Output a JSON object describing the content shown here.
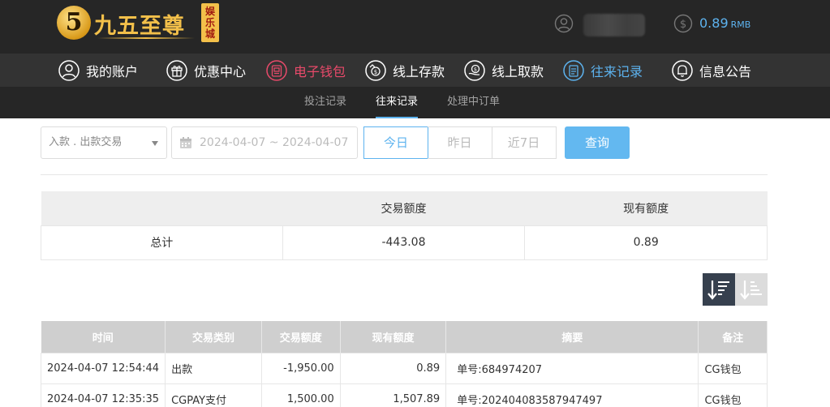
{
  "brand": {
    "logo_mark": "5",
    "name": "九五至尊",
    "badge": "娱乐城"
  },
  "account": {
    "balance": "0.89",
    "currency": "RMB",
    "user_icon": "user-avatar-icon",
    "balance_icon": "dollar-coin-icon"
  },
  "main_nav": [
    {
      "label": "我的账户",
      "icon": "user-icon"
    },
    {
      "label": "优惠中心",
      "icon": "gift-icon"
    },
    {
      "label": "电子钱包",
      "icon": "wallet-icon"
    },
    {
      "label": "线上存款",
      "icon": "deposit-icon"
    },
    {
      "label": "线上取款",
      "icon": "withdraw-icon"
    },
    {
      "label": "往来记录",
      "icon": "records-icon"
    },
    {
      "label": "信息公告",
      "icon": "bell-icon"
    }
  ],
  "sub_nav": [
    {
      "label": "投注记录"
    },
    {
      "label": "往来记录"
    },
    {
      "label": "处理中订单"
    }
  ],
  "filters": {
    "type_select": "入款 . 出款交易",
    "date_range": "2024-04-07 ~ 2024-04-07",
    "quick": [
      "今日",
      "昨日",
      "近7日"
    ],
    "query_label": "查询"
  },
  "summary": {
    "headers": [
      "",
      "交易额度",
      "现有额度"
    ],
    "row": [
      "总计",
      "-443.08",
      "0.89"
    ]
  },
  "records": {
    "headers": [
      "时间",
      "交易类别",
      "交易额度",
      "现有额度",
      "摘要",
      "备注"
    ],
    "rows": [
      [
        "2024-04-07 12:54:44",
        "出款",
        "-1,950.00",
        "0.89",
        "单号:684974207",
        "CG钱包"
      ],
      [
        "2024-04-07 12:35:35",
        "CGPAY支付",
        "1,500.00",
        "1,507.89",
        "单号:202404083587947497",
        "CG钱包"
      ]
    ]
  },
  "colors": {
    "header_bg": "#262626",
    "nav_bg": "#333333",
    "accent_blue": "#5db3ef",
    "accent_red": "#e84a6a",
    "gold": "#f3c04a"
  }
}
